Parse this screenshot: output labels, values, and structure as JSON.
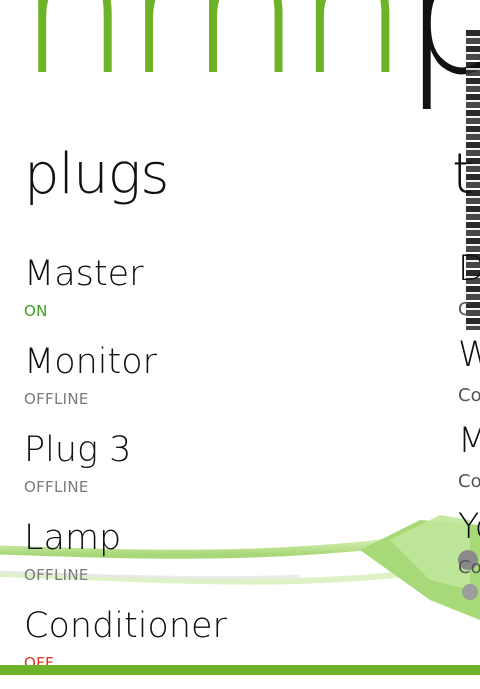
{
  "app": {
    "hero_green": "nrnn",
    "hero_black": "pl"
  },
  "section": {
    "title": "plugs",
    "peek_title": "t"
  },
  "plugs": [
    {
      "name": "Master",
      "status": "ON",
      "state": "on"
    },
    {
      "name": "Monitor",
      "status": "OFFLINE",
      "state": "offline"
    },
    {
      "name": "Plug 3",
      "status": "OFFLINE",
      "state": "offline"
    },
    {
      "name": "Lamp",
      "status": "OFFLINE",
      "state": "offline"
    },
    {
      "name": "Conditioner",
      "status": "OFF",
      "state": "off"
    }
  ],
  "peek": [
    {
      "name": "D",
      "status": "C"
    },
    {
      "name": "W",
      "status": "Co"
    },
    {
      "name": "M",
      "status": "Co"
    },
    {
      "name": "Yo",
      "status": "Co"
    }
  ],
  "colors": {
    "accent": "#6cb32a",
    "on": "#3ca01e",
    "offline": "#7a7a7a",
    "off": "#e0321e"
  }
}
